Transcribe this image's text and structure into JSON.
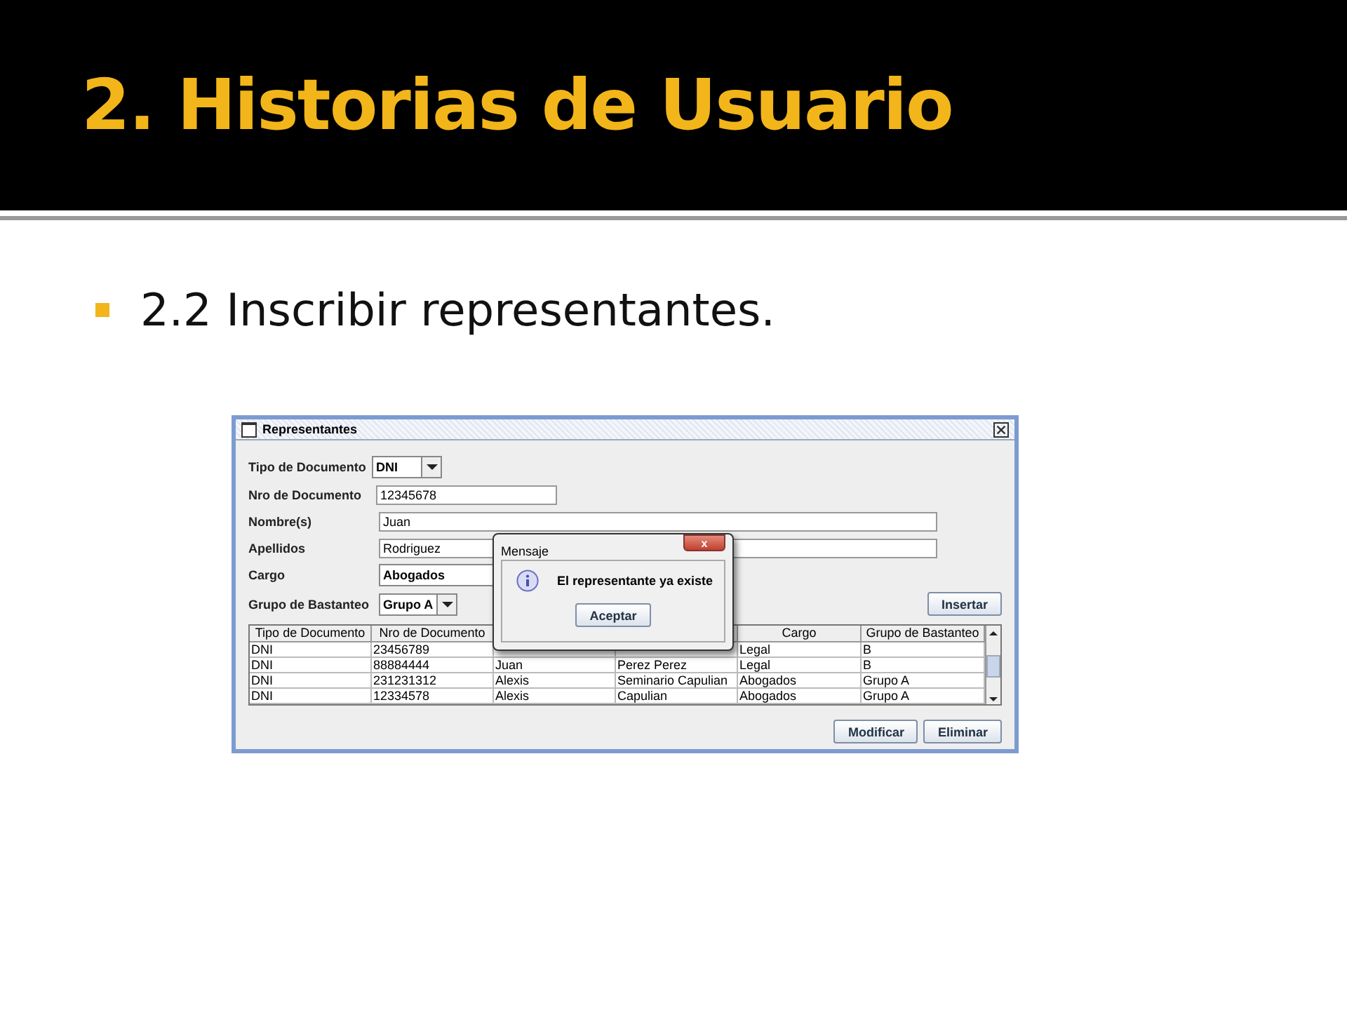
{
  "slide": {
    "title": "2. Historias de Usuario",
    "bullets": [
      "2.2 Inscribir representantes."
    ]
  },
  "window": {
    "title": "Representantes",
    "form": [
      {
        "kind": "combo",
        "label": "Tipo de Documento",
        "value": "DNI"
      },
      {
        "kind": "field",
        "label": "Nro de Documento",
        "value": "12345678"
      },
      {
        "kind": "field",
        "label": "Nombre(s)",
        "value": "Juan"
      },
      {
        "kind": "field",
        "label": "Apellidos",
        "value": "Rodriguez"
      },
      {
        "kind": "combo",
        "label": "Cargo",
        "value": "Abogados"
      },
      {
        "kind": "combo",
        "label": "Grupo de Bastanteo",
        "value": "Grupo A"
      }
    ],
    "insert_button": "Insertar",
    "table": {
      "columns": [
        "Tipo de Documento",
        "Nro de Documento",
        null,
        null,
        "Cargo",
        "Grupo de Bastanteo"
      ],
      "rows": [
        [
          "DNI",
          "23456789",
          null,
          null,
          "Legal",
          "B"
        ],
        [
          "DNI",
          "88884444",
          "Juan",
          "Perez Perez",
          "Legal",
          "B"
        ],
        [
          "DNI",
          "231231312",
          "Alexis",
          "Seminario Capulian",
          "Abogados",
          "Grupo A"
        ],
        [
          "DNI",
          "12334578",
          "Alexis",
          "Capulian",
          "Abogados",
          "Grupo A"
        ]
      ]
    },
    "buttons": [
      "Modificar",
      "Eliminar"
    ]
  },
  "dialog": {
    "title": "Mensaje",
    "close": "x",
    "message": "El representante ya existe",
    "button": "Aceptar"
  }
}
